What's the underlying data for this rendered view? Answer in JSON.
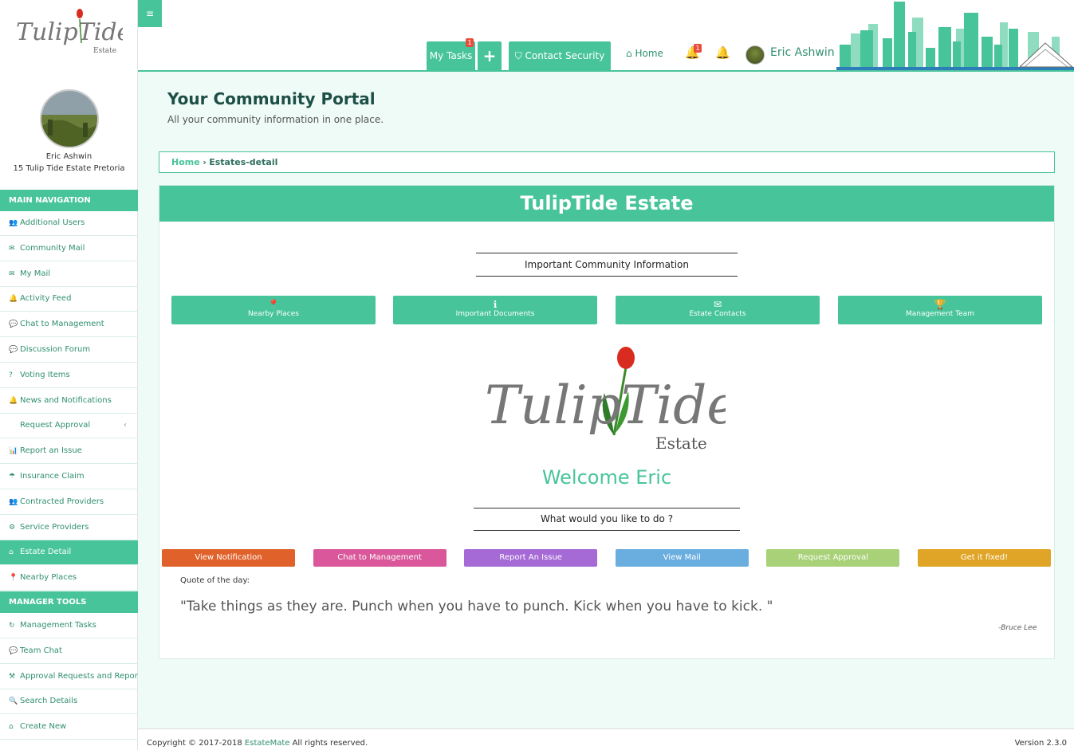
{
  "sidebar": {
    "logo_text": "TulipTide",
    "logo_sub": "Estate",
    "profile": {
      "name": "Eric Ashwin",
      "address": "15 Tulip Tide Estate Pretoria"
    },
    "main_nav_header": "MAIN NAVIGATION",
    "main_nav": [
      {
        "label": "Additional Users",
        "icon": "add-user-icon",
        "glyph": "👥"
      },
      {
        "label": "Community Mail",
        "icon": "envelope-icon",
        "glyph": "✉"
      },
      {
        "label": "My Mail",
        "icon": "envelope-outline-icon",
        "glyph": "✉"
      },
      {
        "label": "Activity Feed",
        "icon": "bell-outline-icon",
        "glyph": "🔔"
      },
      {
        "label": "Chat to Management",
        "icon": "chat-icon",
        "glyph": "💬"
      },
      {
        "label": "Discussion Forum",
        "icon": "comments-icon",
        "glyph": "💬"
      },
      {
        "label": "Voting Items",
        "icon": "question-icon",
        "glyph": "?"
      },
      {
        "label": "News and Notifications",
        "icon": "bell-outline-icon",
        "glyph": "🔔"
      },
      {
        "label": "Request Approval",
        "icon": "none",
        "glyph": "",
        "chevron": "‹"
      },
      {
        "label": "Report an Issue",
        "icon": "bar-chart-icon",
        "glyph": "📊"
      },
      {
        "label": "Insurance Claim",
        "icon": "umbrella-icon",
        "glyph": "☂"
      },
      {
        "label": "Contracted Providers",
        "icon": "users-icon",
        "glyph": "👥"
      },
      {
        "label": "Service Providers",
        "icon": "cogs-icon",
        "glyph": "⚙"
      },
      {
        "label": "Estate Detail",
        "icon": "home-icon",
        "glyph": "⌂",
        "active": true
      },
      {
        "label": "Nearby Places",
        "icon": "map-marker-icon",
        "glyph": "📍"
      }
    ],
    "manager_tools_header": "MANAGER TOOLS",
    "manager_tools": [
      {
        "label": "Management Tasks",
        "icon": "history-icon",
        "glyph": "↻"
      },
      {
        "label": "Team Chat",
        "icon": "chat-icon",
        "glyph": "💬"
      },
      {
        "label": "Approval Requests and Reports",
        "icon": "gavel-icon",
        "glyph": "⚒"
      },
      {
        "label": "Search Details",
        "icon": "search-icon",
        "glyph": "🔍"
      },
      {
        "label": "Create New",
        "icon": "home-icon",
        "glyph": "⌂"
      }
    ]
  },
  "topbar": {
    "menu_toggle": "≡",
    "my_tasks": "My Tasks",
    "my_tasks_badge": "1",
    "add_label": "+",
    "contact_security": "Contact Security",
    "contact_security_icon": "shield-icon",
    "home_label": "Home",
    "notif_badge": "1",
    "username": "Eric Ashwin"
  },
  "main": {
    "title": "Your Community Portal",
    "subtitle": "All your community information in one place.",
    "breadcrumb": {
      "home": "Home",
      "separator": "›",
      "current": "Estates-detail"
    },
    "panel_title": "TulipTide Estate",
    "info_title": "Important Community Information",
    "info_buttons": [
      {
        "label": "Nearby Places",
        "icon": "map-marker-icon",
        "glyph": "📍"
      },
      {
        "label": "Important Documents",
        "icon": "info-icon",
        "glyph": "ℹ"
      },
      {
        "label": "Estate Contacts",
        "icon": "envelope-icon",
        "glyph": "✉"
      },
      {
        "label": "Management Team",
        "icon": "trophy-icon",
        "glyph": "🏆"
      }
    ],
    "welcome": "Welcome Eric",
    "todo_title": "What would you like to do ?",
    "action_buttons": [
      {
        "label": "View Notification",
        "color": "#e0622a"
      },
      {
        "label": "Chat to Management",
        "color": "#d9579a"
      },
      {
        "label": "Report An Issue",
        "color": "#a56ad6"
      },
      {
        "label": "View Mail",
        "color": "#6aaee0"
      },
      {
        "label": "Request Approval",
        "color": "#a8d178"
      },
      {
        "label": "Get it fixed!",
        "color": "#e0a526"
      }
    ],
    "quote_label": "Quote of the day:",
    "quote_text": "\"Take things as they are. Punch when you have to punch. Kick when you have to kick. \"",
    "quote_author": "-Bruce Lee"
  },
  "footer": {
    "copyright_prefix": "Copyright © 2017-2018",
    "brand": "EstateMate",
    "copyright_suffix": "All rights reserved.",
    "version": "Version 2.3.0"
  },
  "colors": {
    "accent": "#48c49a",
    "dark_accent": "#2f8f6e",
    "background": "#eefbf6"
  }
}
